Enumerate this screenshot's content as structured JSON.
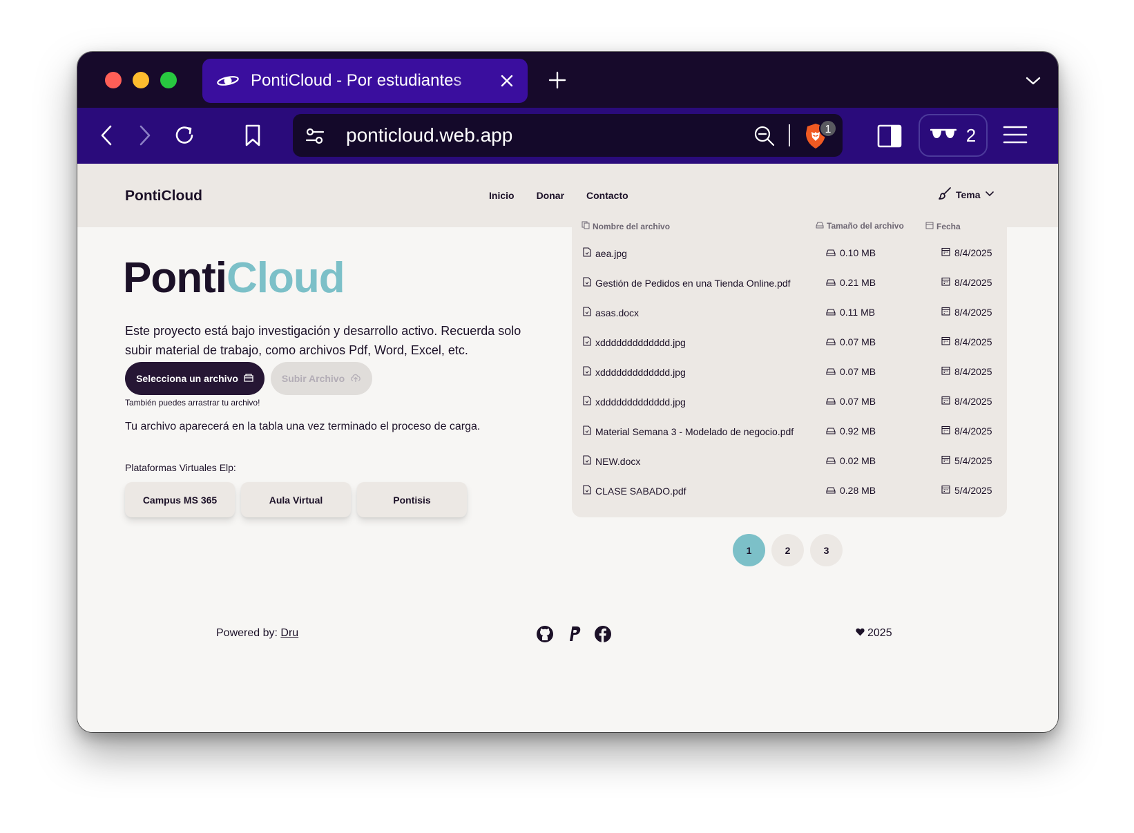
{
  "browser": {
    "tab_title": "PontiCloud - Por estudiantes",
    "url": "ponticloud.web.app",
    "shields_count": "1",
    "private_windows_count": "2"
  },
  "navbar": {
    "brand": "PontiCloud",
    "links": [
      "Inicio",
      "Donar",
      "Contacto"
    ],
    "theme_label": "Tema"
  },
  "hero": {
    "title_part1": "Ponti",
    "title_part2": "Cloud",
    "description": "Este proyecto está bajo investigación y desarrollo activo. Recuerda solo subir material de trabajo, como archivos Pdf, Word, Excel, etc.",
    "select_button": "Selecciona un archivo",
    "upload_button": "Subir Archivo",
    "drag_hint": "También puedes arrastrar tu archivo!",
    "appear_note": "Tu archivo aparecerá en la tabla una vez terminado el proceso de carga.",
    "platforms_label": "Plataformas Virtuales Elp:",
    "platforms": [
      "Campus MS 365",
      "Aula Virtual",
      "Pontisis"
    ]
  },
  "files": {
    "headers": {
      "name": "Nombre del archivo",
      "size": "Tamaño del archivo",
      "date": "Fecha"
    },
    "rows": [
      {
        "name": "aea.jpg",
        "size": "0.10 MB",
        "date": "8/4/2025"
      },
      {
        "name": "Gestión de Pedidos en una Tienda Online.pdf",
        "size": "0.21 MB",
        "date": "8/4/2025"
      },
      {
        "name": "asas.docx",
        "size": "0.11 MB",
        "date": "8/4/2025"
      },
      {
        "name": "xddddddddddddd.jpg",
        "size": "0.07 MB",
        "date": "8/4/2025"
      },
      {
        "name": "xddddddddddddd.jpg",
        "size": "0.07 MB",
        "date": "8/4/2025"
      },
      {
        "name": "xddddddddddddd.jpg",
        "size": "0.07 MB",
        "date": "8/4/2025"
      },
      {
        "name": "Material Semana 3 - Modelado de negocio.pdf",
        "size": "0.92 MB",
        "date": "8/4/2025"
      },
      {
        "name": "NEW.docx",
        "size": "0.02 MB",
        "date": "5/4/2025"
      },
      {
        "name": "CLASE SABADO.pdf",
        "size": "0.28 MB",
        "date": "5/4/2025"
      }
    ]
  },
  "pagination": {
    "pages": [
      "1",
      "2",
      "3"
    ],
    "current": "1"
  },
  "footer": {
    "powered_prefix": "Powered by:",
    "powered_author": "Dru",
    "year": "2025"
  },
  "colors": {
    "accent": "#7cc0c8",
    "dark": "#1c1128",
    "tab_active": "#3a0e9e",
    "toolbar": "#2a0b7b"
  }
}
